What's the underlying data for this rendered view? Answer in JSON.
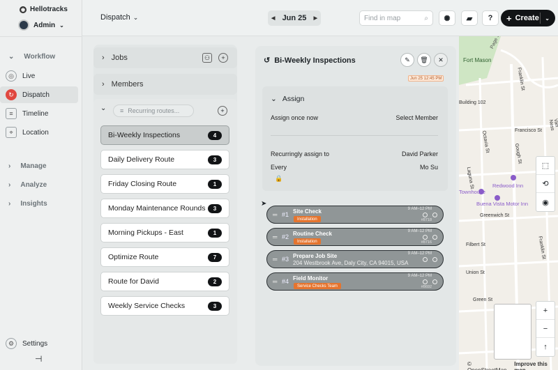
{
  "app": {
    "name": "Hellotracks",
    "user": "Admin"
  },
  "sidebar": {
    "sections": [
      {
        "label": "Workflow",
        "expanded": true
      },
      {
        "label": "Manage"
      },
      {
        "label": "Analyze"
      },
      {
        "label": "Insights"
      }
    ],
    "items": [
      {
        "label": "Live",
        "icon": "live-icon"
      },
      {
        "label": "Dispatch",
        "icon": "dispatch-icon",
        "active": true
      },
      {
        "label": "Timeline",
        "icon": "timeline-icon"
      },
      {
        "label": "Location",
        "icon": "location-icon"
      }
    ],
    "settings": "Settings"
  },
  "topbar": {
    "view": "Dispatch",
    "date": "Jun 25",
    "search_placeholder": "Find in map",
    "help": "?",
    "create": "Create"
  },
  "list": {
    "jobs": "Jobs",
    "members": "Members",
    "filter_placeholder": "Recurring routes...",
    "routes": [
      {
        "name": "Bi-Weekly Inspections",
        "count": "4",
        "selected": true
      },
      {
        "name": "Daily Delivery Route",
        "count": "3"
      },
      {
        "name": "Friday Closing Route",
        "count": "1"
      },
      {
        "name": "Monday Maintenance Rounds",
        "count": "3"
      },
      {
        "name": "Morning Pickups - East",
        "count": "1"
      },
      {
        "name": "Optimize Route",
        "count": "7"
      },
      {
        "name": "Route for David",
        "count": "2"
      },
      {
        "name": "Weekly Service Checks",
        "count": "3"
      }
    ]
  },
  "detail": {
    "title": "Bi-Weekly Inspections",
    "stamp": "Jun 25 12:45 PM",
    "assign": {
      "heading": "Assign",
      "once_label": "Assign once now",
      "once_value": "Select Member",
      "recurring_label": "Recurringly assign to",
      "recurring_value": "David Parker",
      "every_label": "Every",
      "every_value": "Mo Su"
    },
    "stops": [
      {
        "num": "#1",
        "name": "Site Check",
        "tag": "Installation",
        "time": "9 AM–12 PM",
        "ref": "#8718"
      },
      {
        "num": "#2",
        "name": "Routine Check",
        "tag": "Installation",
        "time": "9 AM–12 PM",
        "ref": "#8716"
      },
      {
        "num": "#3",
        "name": "Prepare Job Site",
        "address": "204 Westbrook Ave, Daly City, CA 94015, USA",
        "time": "9 AM–12 PM"
      },
      {
        "num": "#4",
        "name": "Field Monitor",
        "tag": "Service Checks Team",
        "time": "9 AM–12 PM",
        "ref": "#8692"
      }
    ]
  },
  "map": {
    "labels": {
      "page": "Page St",
      "fort_mason": "Fort Mason",
      "building": "Building 102",
      "franklin": "Franklin St",
      "francisco": "Francisco St",
      "octavia": "Octavia St",
      "gough": "Gough St",
      "laguna": "Laguna St",
      "van_ness": "Van Ness",
      "townhouse": "Townhouse",
      "redwood": "Redwood Inn",
      "buena": "Buena Vista Motor Inn",
      "greenwich": "Greenwich St",
      "filbert": "Filbert St",
      "union": "Union St",
      "green": "Green St"
    },
    "attribution": "© OpenStreetMap",
    "improve": "Improve this map",
    "colors": {
      "road": "#ffffff",
      "park": "#cfe6c4",
      "poi": "#8a5cc9",
      "block": "#ece8e1"
    }
  }
}
